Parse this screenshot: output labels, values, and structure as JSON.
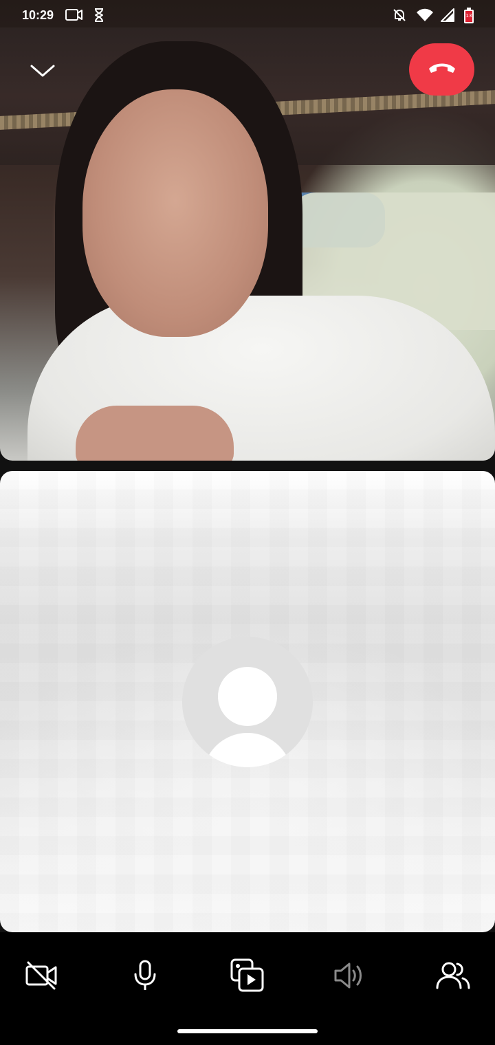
{
  "status_bar": {
    "time": "10:29",
    "left_icons": [
      "video-camera-icon",
      "hourglass-icon"
    ],
    "right_icons": [
      "notifications-off-icon",
      "wifi-icon",
      "cellular-signal-icon",
      "battery-icon"
    ],
    "battery_level": "13"
  },
  "call": {
    "collapse_icon": "chevron-down-icon",
    "end_call_icon": "phone-hangup-icon",
    "end_call_color": "#f03a47"
  },
  "self_preview": {
    "avatar_icon": "person-placeholder-icon"
  },
  "controls": {
    "items": [
      {
        "icon": "video-off-icon"
      },
      {
        "icon": "microphone-icon"
      },
      {
        "icon": "media-gallery-icon"
      },
      {
        "icon": "speaker-icon"
      },
      {
        "icon": "add-people-icon"
      }
    ]
  }
}
